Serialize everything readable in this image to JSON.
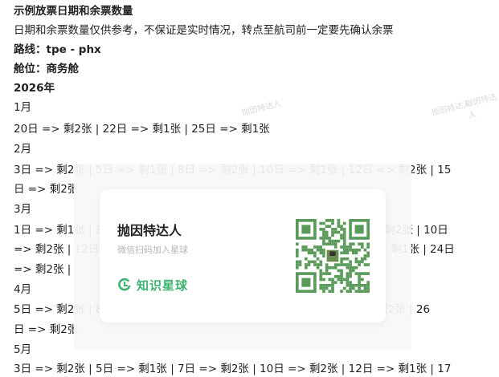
{
  "lines": [
    {
      "text": "示例放票日期和余票数量",
      "bold": true
    },
    {
      "text": "日期和余票数量仅供参考，不保证是实时情况，转点至航司前一定要先确认余票",
      "bold": false
    },
    {
      "text": "路线：tpe - phx",
      "bold": true
    },
    {
      "text": "舱位：商务舱",
      "bold": true
    },
    {
      "text": "2026年",
      "bold": true
    },
    {
      "text": "1月",
      "bold": false
    },
    {
      "text": "20日 => 剩2张 |  22日 => 剩1张 |  25日 => 剩1张",
      "bold": false
    },
    {
      "text": "2月",
      "bold": false
    },
    {
      "text": "3日 => 剩2张 |  5日 => 剩1张 |  8日 => 剩2张 |  10日 => 剩1张 |  12日 => 剩2张 |  15",
      "bold": false
    },
    {
      "text": "日 => 剩2张",
      "bold": false
    },
    {
      "text": "3月",
      "bold": false
    },
    {
      "text": "1日 => 剩1张 |  3日 => 剩2张 |  5日 => 剩1张 |  7日 => 剩1张 |  8日 => 剩2张 |  10日",
      "bold": false
    },
    {
      "text": "=> 剩2张 |  12日 => 剩1张 |  15日 => 剩2张 |  18日 => 剩1张 |  20日 => 剩1张 |  24日",
      "bold": false
    },
    {
      "text": "=> 剩2张 |",
      "bold": false
    },
    {
      "text": "4月",
      "bold": false
    },
    {
      "text": "5日 => 剩2张 |  8日 => 剩1张 |  12日 => 剩2张 |  15日 => 剩1张 |  => 剩2张 |  26",
      "bold": false
    },
    {
      "text": "日 => 剩2张",
      "bold": false
    },
    {
      "text": "5月",
      "bold": false
    },
    {
      "text": "3日 => 剩2张 |  5日 => 剩1张 |  7日 => 剩2张 |  10日 => 剩2张 |  12日 => 剩1张 |  17",
      "bold": false
    }
  ],
  "popup": {
    "title": "抛因特达人",
    "subtitle": "微信扫码加入星球",
    "brand": "知识星球",
    "qr_icon": "qr-code-icon",
    "brand_color": "#3cb371",
    "qr_color": "#5a9a5a"
  },
  "watermark": "抛因特达人"
}
